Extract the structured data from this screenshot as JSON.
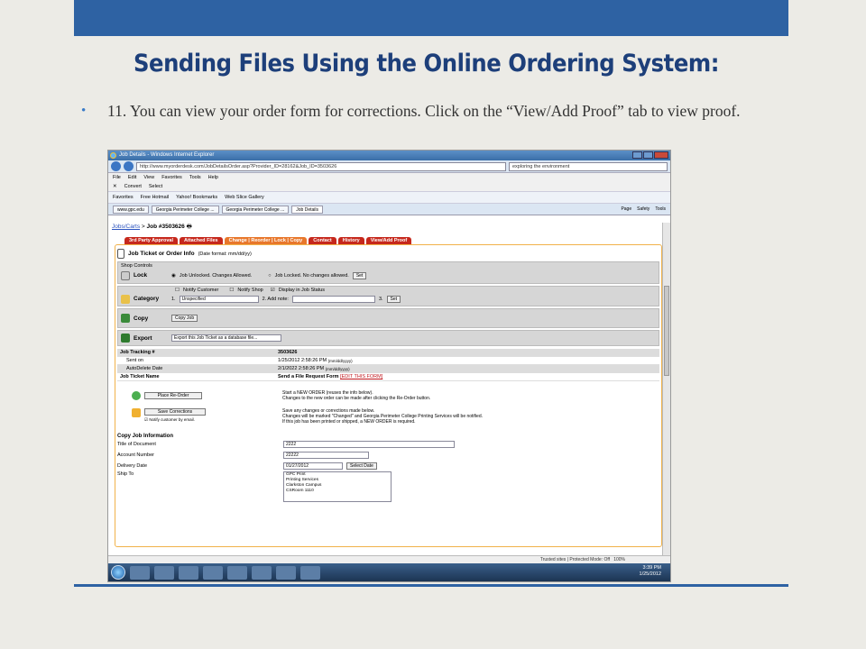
{
  "slide": {
    "title": "Sending Files Using the Online Ordering System:",
    "bullet": "11.  You can view your order form for corrections. Click on the “View/Add Proof” tab to view proof.",
    "bullet_marker": "•"
  },
  "browser": {
    "window_title": "Job Details - Windows Internet Explorer",
    "url": "http://www.myorderdesk.com/JobDetailsOrder.asp?Provider_ID=28162&Job_ID=3503626",
    "search_text": "exploring the environment",
    "menu": [
      "File",
      "Edit",
      "View",
      "Favorites",
      "Tools",
      "Help"
    ],
    "toolbar": [
      "Convert",
      "Select"
    ],
    "favorites": [
      "Favorites",
      "Free Hotmail",
      "Yahoo! Bookmarks",
      "Web Slice Gallery"
    ],
    "tabs": [
      "www.gpc.edu",
      "Georgia Perimeter College ...",
      "Georgia Perimeter College ...",
      "Job Details"
    ],
    "tab_tools": [
      "Page",
      "Safety",
      "Tools"
    ],
    "status_text": "Trusted sites | Protected Mode: Off",
    "zoom": "100%",
    "clock_time": "3:39 PM",
    "clock_date": "1/25/2012"
  },
  "page": {
    "breadcrumb_link": "Jobs/Carts",
    "breadcrumb_rest": "Job #3503626",
    "job_tabs": [
      "3rd Party Approval",
      "Attached Files",
      "Change | Reorder | Lock | Copy",
      "Contact",
      "History",
      "View/Add Proof"
    ],
    "ticket_title": "Job Ticket or Order Info",
    "ticket_date_format": "(Date format: mm/dd/yy)",
    "shop_controls": "Shop Controls",
    "lock_label": "Lock",
    "lock_opt1": "Job Unlocked. Changes Allowed.",
    "lock_opt2": "Job Locked. No changes allowed.",
    "set_label": "Set",
    "notify_customer": "Notify Customer",
    "notify_shop": "Notify Shop",
    "display_status": "Display in Job Status",
    "category_label": "Category",
    "category_step1": "1.",
    "category_value": "Unspecified",
    "category_step2": "2. Add note:",
    "category_step3": "3.",
    "copy_label": "Copy",
    "copy_button": "Copy Job",
    "export_label": "Export",
    "export_value": "Export this Job Ticket as a database file...",
    "tracking": [
      {
        "label": "Job Tracking #",
        "value": "3503626",
        "bold": true
      },
      {
        "label": "Sent on",
        "value": "1/25/2012 2:58:26 PM",
        "suffix": "(mm/dd/yyyy)"
      },
      {
        "label": "AutoDelete Date",
        "value": "2/1/2022 2:58:26 PM",
        "suffix": "(mm/dd/yyyy)"
      }
    ],
    "ticket_name_label": "Job Ticket Name",
    "ticket_name_value": "Send a File Request Form",
    "edit_form": "[EDIT THIS FORM]",
    "reorder_button": "Place Re-Order",
    "reorder_notes": [
      "Start a NEW ORDER (reuses the info below).",
      "Changes to the new order can be made after clicking the Re-Order button."
    ],
    "save_button": "Save Corrections",
    "notify_email": "Notify customer by email.",
    "save_notes": [
      "Save any changes or corrections made below.",
      "Changes will be marked \"Changed\" and Georgia Perimeter College Printing Services will be notified.",
      "If this job has been printed or shipped, a NEW ORDER is required."
    ],
    "copy_info_title": "Copy Job Information",
    "fields": [
      {
        "label": "Title of Document",
        "value": "2222"
      },
      {
        "label": "Account Number",
        "value": "22222"
      },
      {
        "label": "Delivery Date",
        "value": "01/27/2012"
      }
    ],
    "select_date": "Select Date",
    "ship_to_label": "Ship To",
    "ship_to_lines": [
      "GPC Print",
      "Printing Services",
      "Clarkston Campus",
      "CSRoom 1110"
    ]
  }
}
